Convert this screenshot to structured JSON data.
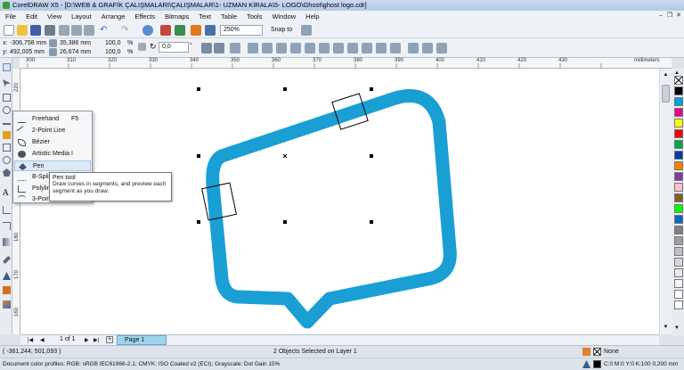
{
  "window": {
    "title": "CorelDRAW X5 - [D:\\WEB & GRAFİK ÇALIŞMALARI\\ÇALIŞMALAR\\1- UZMAN KİRALA\\5- LOGO\\Ghost\\ghost logo.cdr]"
  },
  "menu": [
    "File",
    "Edit",
    "View",
    "Layout",
    "Arrange",
    "Effects",
    "Bitmaps",
    "Text",
    "Table",
    "Tools",
    "Window",
    "Help"
  ],
  "toolbar": {
    "zoom": "250%",
    "snap_to": "Snap to"
  },
  "property_bar": {
    "x": "-306,758 mm",
    "y": "492,005 mm",
    "width": "35,386 mm",
    "height": "26,674 mm",
    "scale_x": "100,0",
    "scale_y": "100,0",
    "scale_unit": "%",
    "rotation": "0,0",
    "rotation_unit": "°"
  },
  "ruler": {
    "h_labels": [
      "300",
      "310",
      "320",
      "330",
      "340",
      "350",
      "360",
      "370",
      "380",
      "390",
      "400",
      "410",
      "420",
      "430"
    ],
    "units": "millimeters",
    "v_labels": [
      "220",
      "210",
      "200",
      "190",
      "180",
      "170",
      "160"
    ]
  },
  "flyout": {
    "items": [
      {
        "label": "Freehand",
        "shortcut": "F5"
      },
      {
        "label": "2-Point Line",
        "shortcut": ""
      },
      {
        "label": "Bézier",
        "shortcut": ""
      },
      {
        "label": "Artistic Media",
        "shortcut": "I"
      },
      {
        "label": "Pen",
        "shortcut": ""
      },
      {
        "label": "B-Spline",
        "shortcut": ""
      },
      {
        "label": "Polyline",
        "shortcut": ""
      },
      {
        "label": "3-Point Curve",
        "shortcut": ""
      }
    ]
  },
  "tooltip": {
    "title": "Pen tool",
    "description": "Draw curves in segments, and preview each segment as you draw."
  },
  "page_nav": {
    "counter": "1 of 1",
    "tab": "Page 1"
  },
  "status": {
    "coords": "( -361,244; 501,093 )",
    "selection": "2 Objects Selected on Layer 1",
    "fill": "None",
    "profiles": "Document color profiles: RGB: sRGB IEC61966-2.1; CMYK: ISO Coated v2 (ECI); Grayscale: Dot Gain 15%",
    "outline": "C:0 M:0 Y:0 K:100  0,200 mm"
  },
  "colors": {
    "accent": "#1a9fd4",
    "palette": [
      "#ffffff",
      "#000000",
      "#ff0000",
      "#ff8000",
      "#ffff00",
      "#00a650",
      "#00a0e3",
      "#003da5",
      "#ec008c",
      "#7f3f98",
      "#8b5a2b",
      "#808080",
      "#c0c0c0",
      "#00ff00",
      "#ffc0cb",
      "#a52a2a"
    ]
  },
  "icons": [
    "pick-tool-icon",
    "shape-tool-icon",
    "crop-tool-icon",
    "zoom-tool-icon",
    "freehand-tool-icon",
    "smart-fill-icon",
    "rectangle-tool-icon",
    "ellipse-tool-icon",
    "polygon-tool-icon",
    "text-tool-icon",
    "dimension-tool-icon",
    "connector-tool-icon",
    "blend-tool-icon",
    "eyedropper-icon",
    "outline-pen-icon",
    "fill-tool-icon",
    "interactive-fill-icon"
  ]
}
